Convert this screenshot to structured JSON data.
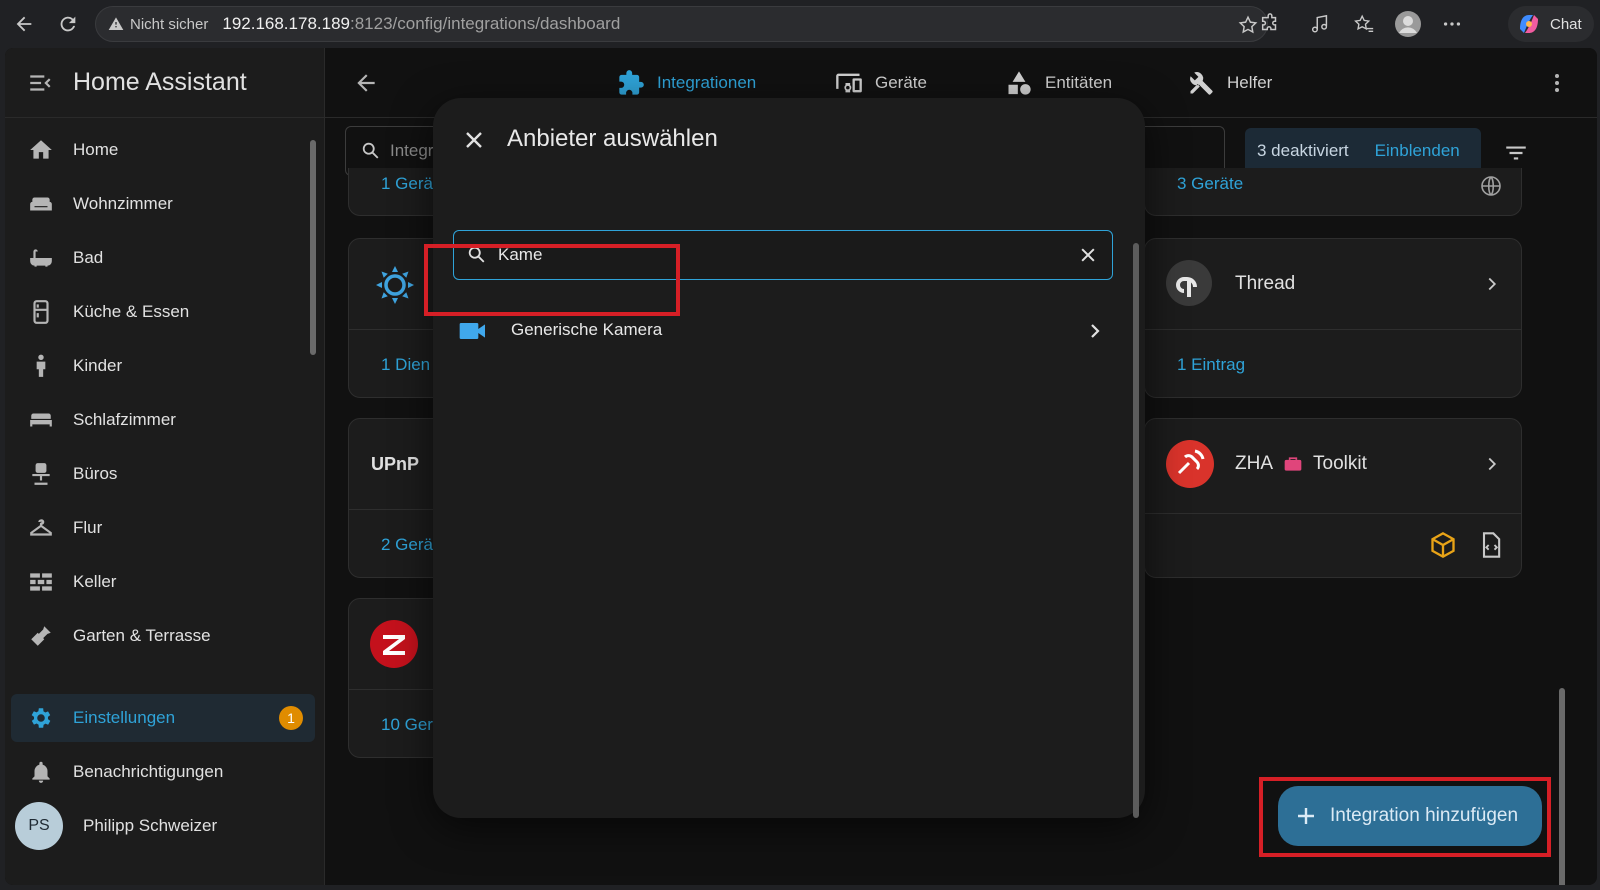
{
  "browser": {
    "security": "Nicht sicher",
    "url_host": "192.168.178.189",
    "url_rest": ":8123/config/integrations/dashboard",
    "chat_label": "Chat"
  },
  "sidebar": {
    "title": "Home Assistant",
    "items": [
      {
        "label": "Home",
        "icon": "home-icon"
      },
      {
        "label": "Wohnzimmer",
        "icon": "sofa-icon"
      },
      {
        "label": "Bad",
        "icon": "bathtub-icon"
      },
      {
        "label": "Küche & Essen",
        "icon": "fridge-icon"
      },
      {
        "label": "Kinder",
        "icon": "child-icon"
      },
      {
        "label": "Schlafzimmer",
        "icon": "bed-icon"
      },
      {
        "label": "Büros",
        "icon": "desk-chair-icon"
      },
      {
        "label": "Flur",
        "icon": "hanger-icon"
      },
      {
        "label": "Keller",
        "icon": "wall-icon"
      },
      {
        "label": "Garten & Terrasse",
        "icon": "shovel-icon"
      }
    ],
    "settings_label": "Einstellungen",
    "settings_badge": "1",
    "notifications_label": "Benachrichtigungen",
    "user_initials": "PS",
    "user_name": "Philipp Schweizer"
  },
  "topbar": {
    "tabs": [
      {
        "label": "Integrationen",
        "active": true
      },
      {
        "label": "Geräte",
        "active": false
      },
      {
        "label": "Entitäten",
        "active": false
      },
      {
        "label": "Helfer",
        "active": false
      }
    ]
  },
  "filter": {
    "search_placeholder": "Integra",
    "hidden_count": "3 deaktiviert",
    "show_label": "Einblenden"
  },
  "cards": {
    "left_top_footer": "1 Gerä",
    "left_1_footer": "1 Dien",
    "left_2_logo": "UPnP",
    "left_2_footer": "2 Gerä",
    "left_3_footer": "10 Ger",
    "right_top_footer": "3 Geräte",
    "thread_title": "Thread",
    "thread_footer": "1 Eintrag",
    "zha_title": "ZHA",
    "zha_suffix": "Toolkit"
  },
  "dialog": {
    "title": "Anbieter auswählen",
    "search_value": "Kame",
    "result_label": "Generische Kamera"
  },
  "fab": {
    "label": "Integration hinzufügen"
  },
  "colors": {
    "accent": "#2fa3d8",
    "highlight": "#d61f26",
    "badge": "#e08c00"
  }
}
